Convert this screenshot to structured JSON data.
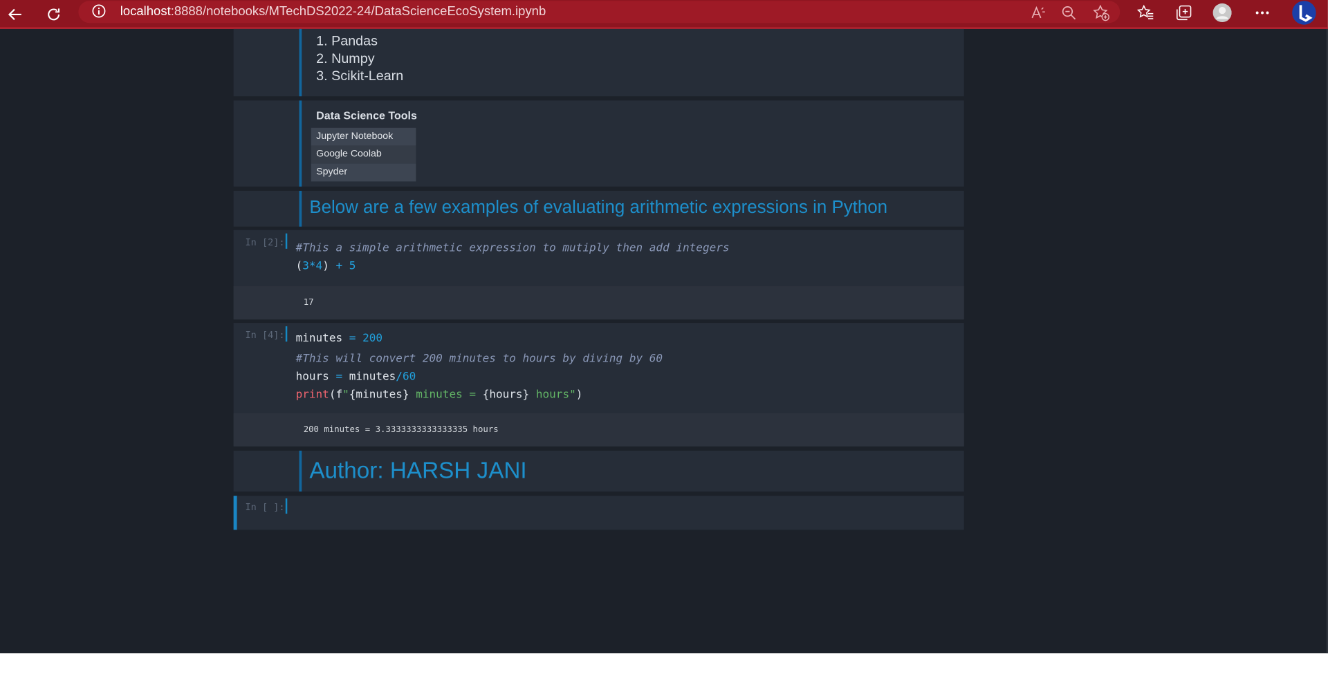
{
  "browser": {
    "url_host": "localhost",
    "url_rest": ":8888/notebooks/MTechDS2022-24/DataScienceEcoSystem.ipynb"
  },
  "notebook": {
    "libraries": [
      "1. Pandas",
      "2. Numpy",
      "3. Scikit-Learn"
    ],
    "tools_heading": "Data Science Tools",
    "tools": [
      "Jupyter Notebook",
      "Google Coolab",
      "Spyder"
    ],
    "examples_heading": "Below are a few examples of evaluating arithmetic expressions in Python",
    "cell1": {
      "prompt": "In [2]:",
      "comment": "#This a simple arithmetic expression to mutiply then add integers",
      "output": "17"
    },
    "cell2": {
      "prompt": "In [4]:",
      "comment": "#This will convert 200 minutes to hours by diving by 60",
      "output": "200 minutes = 3.3333333333333335 hours"
    },
    "author": "Author: HARSH JANI",
    "empty_prompt": "In [ ]:"
  },
  "colors": {
    "titlebar": "#8e1520",
    "page_bg": "#1c2129",
    "cell_bg": "#262d38",
    "accent": "#1d8fcb"
  }
}
